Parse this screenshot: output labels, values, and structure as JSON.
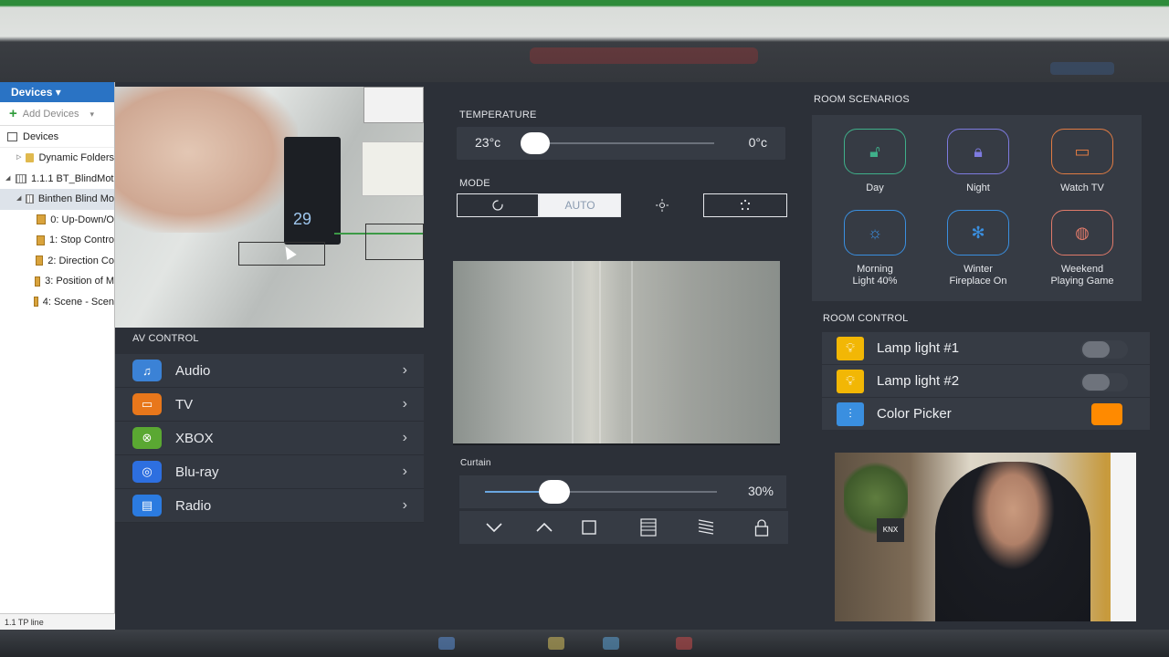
{
  "ets": {
    "devices_tab": "Devices ▾",
    "add_devices": "Add Devices",
    "devices_root": "Devices",
    "tree": [
      {
        "label": "Dynamic Folders",
        "icon": "folder-icon",
        "indent": 1
      },
      {
        "label": "1.1.1 BT_BlindMot",
        "icon": "device-icon",
        "indent": 0
      },
      {
        "label": "Binthen Blind Mo",
        "icon": "device-icon",
        "indent": 1
      },
      {
        "label": "0: Up-Down/O",
        "icon": "object-icon",
        "indent": 2
      },
      {
        "label": "1: Stop Contro",
        "icon": "object-icon",
        "indent": 2
      },
      {
        "label": "2: Direction Co",
        "icon": "object-icon",
        "indent": 2
      },
      {
        "label": "3: Position of M",
        "icon": "object-icon",
        "indent": 2
      },
      {
        "label": "4: Scene - Scen",
        "icon": "object-icon",
        "indent": 2
      }
    ],
    "status": "1.1 TP line"
  },
  "camera": {
    "screen_value": "29"
  },
  "av": {
    "title": "AV CONTROL",
    "items": [
      {
        "label": "Audio",
        "icon": "music-note-icon",
        "color": "#3b82d6"
      },
      {
        "label": "TV",
        "icon": "tv-icon",
        "color": "#e8771b"
      },
      {
        "label": "XBOX",
        "icon": "xbox-icon",
        "color": "#5aa832"
      },
      {
        "label": "Blu-ray",
        "icon": "bluray-icon",
        "color": "#2d6fe0"
      },
      {
        "label": "Radio",
        "icon": "radio-icon",
        "color": "#2b7be0"
      }
    ]
  },
  "temperature": {
    "title": "TEMPERATURE",
    "current": "23°c",
    "setpoint": "0°c"
  },
  "mode": {
    "title": "MODE",
    "auto_label": "AUTO"
  },
  "curtain": {
    "title": "Curtain",
    "value": "30%",
    "value_num": 30
  },
  "scenarios": {
    "title": "ROOM SCENARIOS",
    "items": [
      {
        "label": "Day",
        "icon": "lock-open-icon",
        "color": "#3fb08a"
      },
      {
        "label": "Night",
        "icon": "lock-icon",
        "color": "#7e7be0"
      },
      {
        "label": "Watch TV",
        "icon": "monitor-icon",
        "color": "#e07b43"
      },
      {
        "label": "Morning\nLight 40%",
        "icon": "sun-icon",
        "color": "#3a8fe0"
      },
      {
        "label": "Winter\nFireplace On",
        "icon": "snowflake-icon",
        "color": "#3a8fe0"
      },
      {
        "label": "Weekend\nPlaying Game",
        "icon": "gamepad-icon",
        "color": "#e07a6a"
      }
    ]
  },
  "room_control": {
    "title": "ROOM CONTROL",
    "items": [
      {
        "label": "Lamp light #1",
        "icon": "bulb-icon",
        "color": "#f2b705",
        "type": "toggle"
      },
      {
        "label": "Lamp light #2",
        "icon": "bulb-icon",
        "color": "#f2b705",
        "type": "toggle"
      },
      {
        "label": "Color Picker",
        "icon": "sliders-icon",
        "color": "#3a8fe0",
        "type": "swatch",
        "swatch": "#ff8a00"
      }
    ]
  },
  "webcam": {
    "sign_text": "KNX"
  }
}
